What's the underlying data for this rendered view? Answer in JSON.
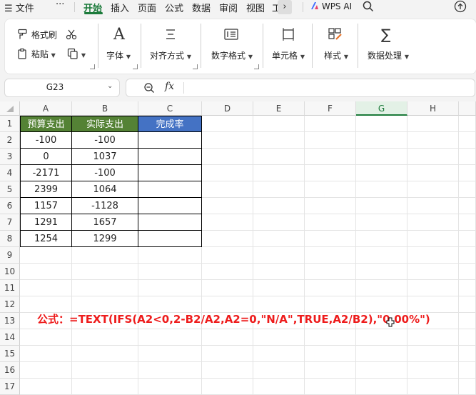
{
  "menu": {
    "file": "文件",
    "more": "···",
    "tabs": [
      "开始",
      "插入",
      "页面",
      "公式",
      "数据",
      "审阅",
      "视图",
      "⼯"
    ],
    "wps_ai": "WPS AI"
  },
  "ribbon": {
    "format_painter": "格式刷",
    "paste": "粘贴",
    "font": "字体",
    "align": "对齐方式",
    "number_format": "数字格式",
    "cell": "单元格",
    "style": "样式",
    "data_processing": "数据处理"
  },
  "formula_bar": {
    "name_box": "G23",
    "fx": "fx",
    "content": ""
  },
  "sheet": {
    "columns": [
      "A",
      "B",
      "C",
      "D",
      "E",
      "F",
      "G",
      "H"
    ],
    "selected_column": "G",
    "rows": [
      "1",
      "2",
      "3",
      "4",
      "5",
      "6",
      "7",
      "8",
      "9",
      "10",
      "11",
      "12",
      "13",
      "14",
      "15",
      "16",
      "17"
    ],
    "headers": [
      "预算支出",
      "实际支出",
      "完成率"
    ],
    "header_colors": [
      "#548235",
      "#548235",
      "#4472c4"
    ],
    "data": [
      [
        "-100",
        "-100",
        ""
      ],
      [
        "0",
        "1037",
        ""
      ],
      [
        "-2171",
        "-100",
        ""
      ],
      [
        "2399",
        "1064",
        ""
      ],
      [
        "1157",
        "-1128",
        ""
      ],
      [
        "1291",
        "1657",
        ""
      ],
      [
        "1254",
        "1299",
        ""
      ]
    ]
  },
  "formula_note": "公式：=TEXT(IFS(A2<0,2-B2/A2,A2=0,\"N/A\",TRUE,A2/B2),\"0.00%\")"
}
